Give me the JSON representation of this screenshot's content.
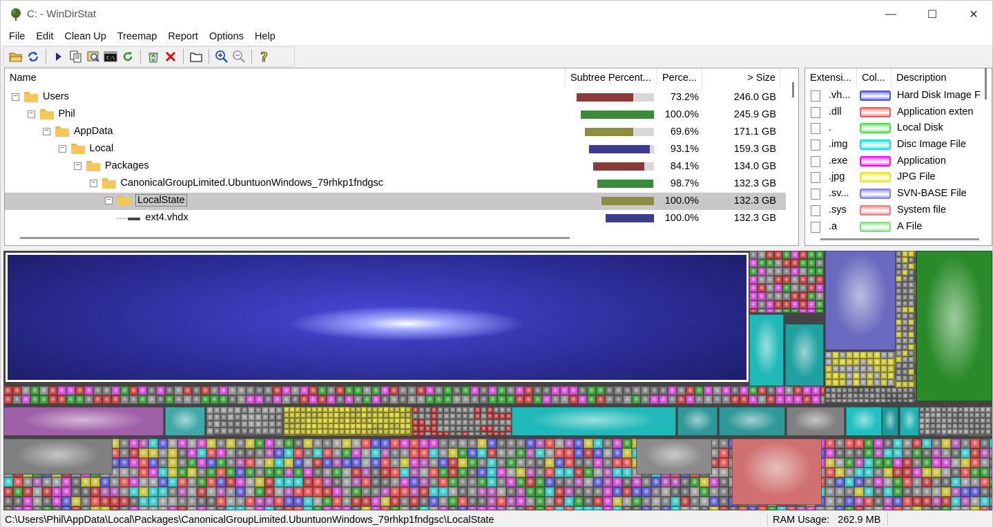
{
  "window": {
    "title": "C: - WinDirStat",
    "minimize": "—",
    "maximize": "☐",
    "close": "✕"
  },
  "menu": [
    "File",
    "Edit",
    "Clean Up",
    "Treemap",
    "Report",
    "Options",
    "Help"
  ],
  "toolbar": [
    {
      "icon": "open-folder-icon",
      "glyph": "📂"
    },
    {
      "icon": "rescan-icon",
      "glyph": "⟳"
    },
    {
      "icon": "play-icon",
      "glyph": "▶"
    },
    {
      "icon": "copy-icon",
      "glyph": "⎘"
    },
    {
      "icon": "explorer-icon",
      "glyph": "🗔"
    },
    {
      "icon": "command-prompt-icon",
      "glyph": "▣"
    },
    {
      "icon": "refresh-icon",
      "glyph": "↻"
    },
    {
      "icon": "recycle-bin-icon",
      "glyph": "♻"
    },
    {
      "icon": "delete-icon",
      "glyph": "✕"
    },
    {
      "icon": "properties-icon",
      "glyph": "▭"
    },
    {
      "icon": "zoom-in-icon",
      "glyph": "⊕"
    },
    {
      "icon": "zoom-out-icon",
      "glyph": "⊖"
    },
    {
      "icon": "help-icon",
      "glyph": "?"
    }
  ],
  "tree": {
    "columns": {
      "name": "Name",
      "subtree": "Subtree Percent...",
      "percent": "Perce...",
      "size": "> Size"
    },
    "rows": [
      {
        "name": "Users",
        "level": 0,
        "type": "folder",
        "fraction": 0.732,
        "bar_color": "#8b3a3a",
        "percent": "73.2%",
        "size": "246.0 GB"
      },
      {
        "name": "Phil",
        "level": 1,
        "type": "folder",
        "fraction": 1.0,
        "bar_color": "#3c8a3c",
        "percent": "100.0%",
        "size": "245.9 GB"
      },
      {
        "name": "AppData",
        "level": 2,
        "type": "folder",
        "fraction": 0.696,
        "bar_color": "#8c8c44",
        "percent": "69.6%",
        "size": "171.1 GB"
      },
      {
        "name": "Local",
        "level": 3,
        "type": "folder",
        "fraction": 0.931,
        "bar_color": "#3c3c8c",
        "percent": "93.1%",
        "size": "159.3 GB"
      },
      {
        "name": "Packages",
        "level": 4,
        "type": "folder",
        "fraction": 0.841,
        "bar_color": "#8b3a3a",
        "percent": "84.1%",
        "size": "134.0 GB"
      },
      {
        "name": "CanonicalGroupLimited.UbuntuonWindows_79rhkp1fndgsc",
        "level": 5,
        "type": "folder",
        "fraction": 0.987,
        "bar_color": "#3c8a3c",
        "percent": "98.7%",
        "size": "132.3 GB"
      },
      {
        "name": "LocalState",
        "level": 6,
        "type": "folder",
        "fraction": 1.0,
        "bar_color": "#8c8c44",
        "percent": "100.0%",
        "size": "132.3 GB",
        "selected": true
      },
      {
        "name": "ext4.vhdx",
        "level": 7,
        "type": "file",
        "fraction": 1.0,
        "bar_color": "#3c3c8c",
        "percent": "100.0%",
        "size": "132.3 GB"
      }
    ]
  },
  "extensions": {
    "columns": {
      "ext": "Extensi...",
      "color": "Col...",
      "desc": "Description"
    },
    "rows": [
      {
        "ext": ".vh...",
        "color": "#5050f0",
        "desc": "Hard Disk Image F"
      },
      {
        "ext": ".dll",
        "color": "#f06060",
        "desc": "Application exten"
      },
      {
        "ext": ".",
        "color": "#50e050",
        "desc": "Local Disk"
      },
      {
        "ext": ".img",
        "color": "#10e0e0",
        "desc": "Disc Image File"
      },
      {
        "ext": ".exe",
        "color": "#f010f0",
        "desc": "Application"
      },
      {
        "ext": ".jpg",
        "color": "#e8e810",
        "desc": "JPG File"
      },
      {
        "ext": ".sv...",
        "color": "#8080e8",
        "desc": "SVN-BASE File"
      },
      {
        "ext": ".sys",
        "color": "#e88080",
        "desc": "System file"
      },
      {
        "ext": ".a",
        "color": "#80e080",
        "desc": "A File"
      }
    ]
  },
  "status": {
    "path": "C:\\Users\\Phil\\AppData\\Local\\Packages\\CanonicalGroupLimited.UbuntuonWindows_79rhkp1fndgsc\\LocalState",
    "ram_label": "RAM Usage:",
    "ram_value": "262.9 MB"
  }
}
